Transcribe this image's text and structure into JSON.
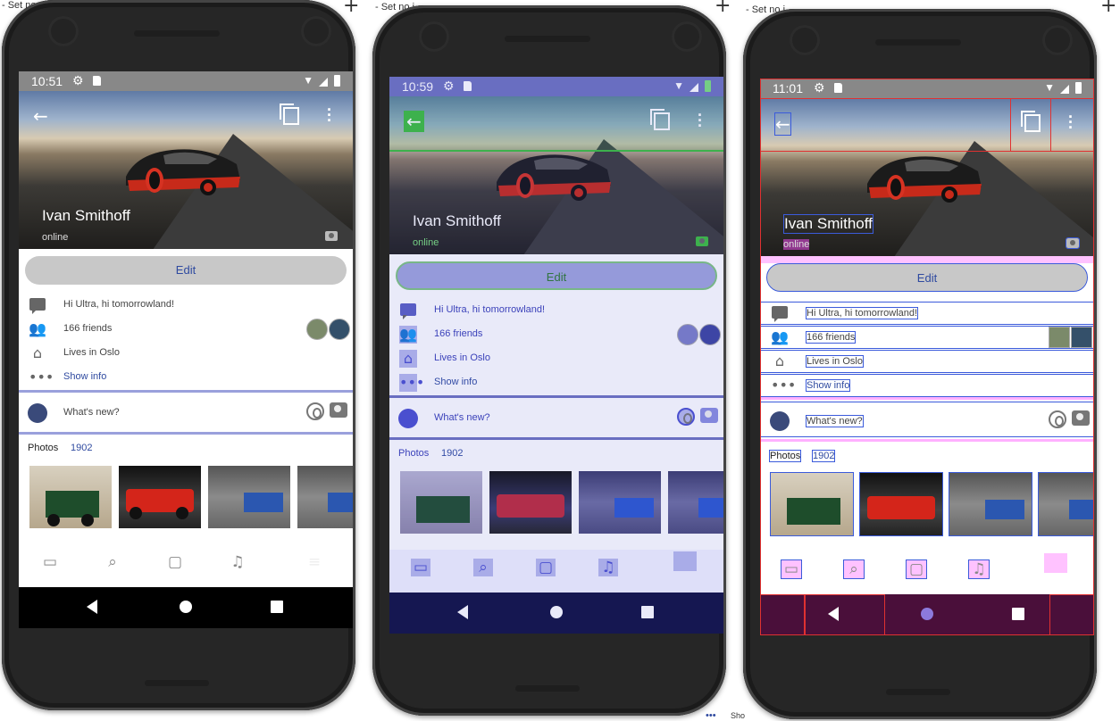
{
  "fragments": {
    "tab_1": "- Set no",
    "tab_2": "- Set no i",
    "tab_3": "- Set no i",
    "bottom_label": "Sho"
  },
  "phones": [
    {
      "time": "10:51",
      "profile": {
        "name": "Ivan Smithoff",
        "status": "online"
      },
      "edit_label": "Edit",
      "info": [
        {
          "icon": "message-icon",
          "text": "Hi Ultra, hi tomorrowland!"
        },
        {
          "icon": "friends-icon",
          "text": "166 friends"
        },
        {
          "icon": "home-icon",
          "text": "Lives in Oslo"
        },
        {
          "icon": "more-horiz-icon",
          "text": "Show info"
        }
      ],
      "whats_new": "What's new?",
      "photos_label": "Photos",
      "photos_count": "1902",
      "nav_items": [
        "feed-icon",
        "search-icon",
        "messages-icon",
        "notifications-icon",
        "menu-icon"
      ]
    },
    {
      "time": "10:59",
      "profile": {
        "name": "Ivan Smithoff",
        "status": "online"
      },
      "edit_label": "Edit",
      "info": [
        {
          "icon": "message-icon",
          "text": "Hi Ultra, hi tomorrowland!"
        },
        {
          "icon": "friends-icon",
          "text": "166 friends"
        },
        {
          "icon": "home-icon",
          "text": "Lives in Oslo"
        },
        {
          "icon": "more-horiz-icon",
          "text": "Show info"
        }
      ],
      "whats_new": "What's new?",
      "photos_label": "Photos",
      "photos_count": "1902",
      "nav_items": [
        "feed-icon",
        "search-icon",
        "messages-icon",
        "notifications-icon",
        "menu-icon"
      ]
    },
    {
      "time": "11:01",
      "profile": {
        "name": "Ivan Smithoff",
        "status": "online"
      },
      "edit_label": "Edit",
      "info": [
        {
          "icon": "message-icon",
          "text": "Hi Ultra, hi tomorrowland!"
        },
        {
          "icon": "friends-icon",
          "text": "166 friends"
        },
        {
          "icon": "home-icon",
          "text": "Lives in Oslo"
        },
        {
          "icon": "more-horiz-icon",
          "text": "Show info"
        }
      ],
      "whats_new": "What's new?",
      "photos_label": "Photos",
      "photos_count": "1902",
      "nav_items": [
        "feed-icon",
        "search-icon",
        "messages-icon",
        "notifications-icon",
        "menu-icon"
      ]
    }
  ],
  "colors": {
    "accent": "#2f4aa0",
    "divider": "#9aa0dc",
    "phone_2_tint": "#4a4fd0",
    "phone_3_outline": "#3b5bdb",
    "phone_3_highlight": "#ff50ff"
  }
}
